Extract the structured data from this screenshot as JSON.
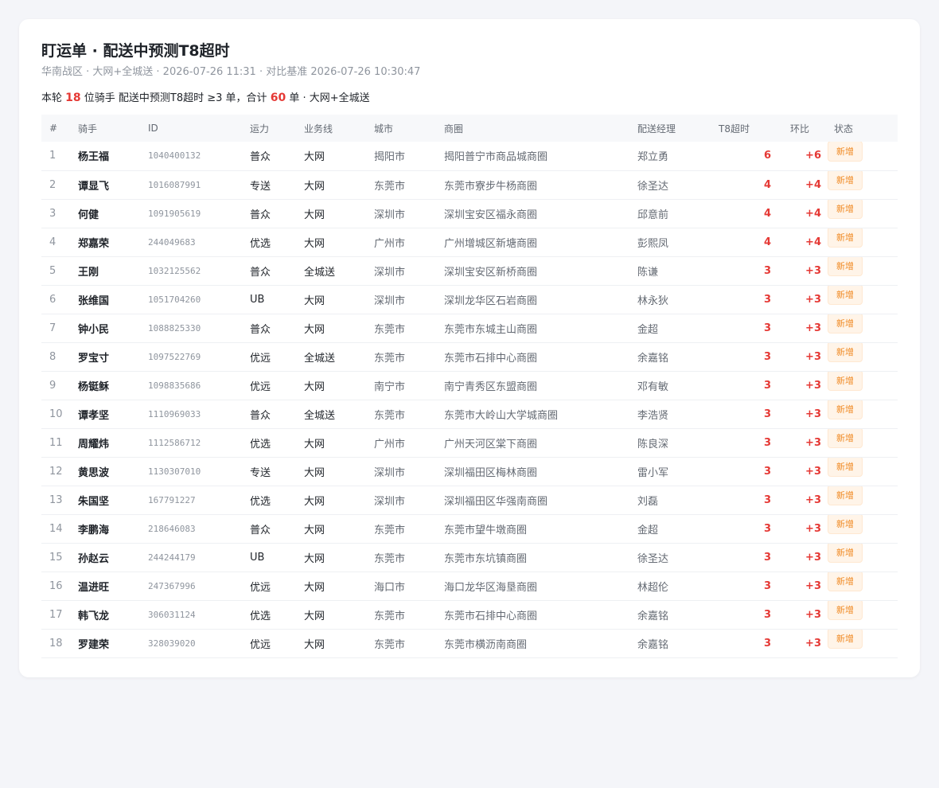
{
  "header": {
    "title": "盯运单 · 配送中预测T8超时",
    "subtitle": "华南战区 · 大网+全城送 · 2026-07-26 11:31 · 对比基准 2026-07-26 10:30:47"
  },
  "summary": {
    "prefix": "本轮",
    "rider_count": "18",
    "middle": "位骑手 配送中预测T8超时 ≥3 单，合计",
    "order_total": "60",
    "suffix": "单 · 大网+全城送"
  },
  "table": {
    "columns": [
      "#",
      "骑手",
      "ID",
      "运力",
      "业务线",
      "城市",
      "商圈",
      "配送经理",
      "T8超时",
      "环比",
      "状态"
    ],
    "rows": [
      {
        "idx": "1",
        "rider": "杨王福",
        "id": "1040400132",
        "cap": "普众",
        "biz": "大网",
        "city": "揭阳市",
        "zone": "揭阳普宁市商品城商圈",
        "mgr": "郑立勇",
        "t8": "6",
        "chg": "+6",
        "status": "新增"
      },
      {
        "idx": "2",
        "rider": "谭显飞",
        "id": "1016087991",
        "cap": "专送",
        "biz": "大网",
        "city": "东莞市",
        "zone": "东莞市寮步牛杨商圈",
        "mgr": "徐圣达",
        "t8": "4",
        "chg": "+4",
        "status": "新增"
      },
      {
        "idx": "3",
        "rider": "何健",
        "id": "1091905619",
        "cap": "普众",
        "biz": "大网",
        "city": "深圳市",
        "zone": "深圳宝安区福永商圈",
        "mgr": "邱意前",
        "t8": "4",
        "chg": "+4",
        "status": "新增"
      },
      {
        "idx": "4",
        "rider": "郑嘉荣",
        "id": "244049683",
        "cap": "优选",
        "biz": "大网",
        "city": "广州市",
        "zone": "广州增城区新塘商圈",
        "mgr": "彭熙凤",
        "t8": "4",
        "chg": "+4",
        "status": "新增"
      },
      {
        "idx": "5",
        "rider": "王刚",
        "id": "1032125562",
        "cap": "普众",
        "biz": "全城送",
        "city": "深圳市",
        "zone": "深圳宝安区新桥商圈",
        "mgr": "陈谦",
        "t8": "3",
        "chg": "+3",
        "status": "新增"
      },
      {
        "idx": "6",
        "rider": "张维国",
        "id": "1051704260",
        "cap": "UB",
        "biz": "大网",
        "city": "深圳市",
        "zone": "深圳龙华区石岩商圈",
        "mgr": "林永狄",
        "t8": "3",
        "chg": "+3",
        "status": "新增"
      },
      {
        "idx": "7",
        "rider": "钟小民",
        "id": "1088825330",
        "cap": "普众",
        "biz": "大网",
        "city": "东莞市",
        "zone": "东莞市东城主山商圈",
        "mgr": "金超",
        "t8": "3",
        "chg": "+3",
        "status": "新增"
      },
      {
        "idx": "8",
        "rider": "罗宝寸",
        "id": "1097522769",
        "cap": "优远",
        "biz": "全城送",
        "city": "东莞市",
        "zone": "东莞市石排中心商圈",
        "mgr": "余嘉铭",
        "t8": "3",
        "chg": "+3",
        "status": "新增"
      },
      {
        "idx": "9",
        "rider": "杨铤稣",
        "id": "1098835686",
        "cap": "优远",
        "biz": "大网",
        "city": "南宁市",
        "zone": "南宁青秀区东盟商圈",
        "mgr": "邓有敏",
        "t8": "3",
        "chg": "+3",
        "status": "新增"
      },
      {
        "idx": "10",
        "rider": "谭孝坚",
        "id": "1110969033",
        "cap": "普众",
        "biz": "全城送",
        "city": "东莞市",
        "zone": "东莞市大岭山大学城商圈",
        "mgr": "李浩贤",
        "t8": "3",
        "chg": "+3",
        "status": "新增"
      },
      {
        "idx": "11",
        "rider": "周耀炜",
        "id": "1112586712",
        "cap": "优选",
        "biz": "大网",
        "city": "广州市",
        "zone": "广州天河区棠下商圈",
        "mgr": "陈良深",
        "t8": "3",
        "chg": "+3",
        "status": "新增"
      },
      {
        "idx": "12",
        "rider": "黄思波",
        "id": "1130307010",
        "cap": "专送",
        "biz": "大网",
        "city": "深圳市",
        "zone": "深圳福田区梅林商圈",
        "mgr": "雷小军",
        "t8": "3",
        "chg": "+3",
        "status": "新增"
      },
      {
        "idx": "13",
        "rider": "朱国坚",
        "id": "167791227",
        "cap": "优选",
        "biz": "大网",
        "city": "深圳市",
        "zone": "深圳福田区华强南商圈",
        "mgr": "刘磊",
        "t8": "3",
        "chg": "+3",
        "status": "新增"
      },
      {
        "idx": "14",
        "rider": "李鹏海",
        "id": "218646083",
        "cap": "普众",
        "biz": "大网",
        "city": "东莞市",
        "zone": "东莞市望牛墩商圈",
        "mgr": "金超",
        "t8": "3",
        "chg": "+3",
        "status": "新增"
      },
      {
        "idx": "15",
        "rider": "孙赵云",
        "id": "244244179",
        "cap": "UB",
        "biz": "大网",
        "city": "东莞市",
        "zone": "东莞市东坑镇商圈",
        "mgr": "徐圣达",
        "t8": "3",
        "chg": "+3",
        "status": "新增"
      },
      {
        "idx": "16",
        "rider": "温进旺",
        "id": "247367996",
        "cap": "优远",
        "biz": "大网",
        "city": "海口市",
        "zone": "海口龙华区海垦商圈",
        "mgr": "林超伦",
        "t8": "3",
        "chg": "+3",
        "status": "新增"
      },
      {
        "idx": "17",
        "rider": "韩飞龙",
        "id": "306031124",
        "cap": "优选",
        "biz": "大网",
        "city": "东莞市",
        "zone": "东莞市石排中心商圈",
        "mgr": "余嘉铭",
        "t8": "3",
        "chg": "+3",
        "status": "新增"
      },
      {
        "idx": "18",
        "rider": "罗建荣",
        "id": "328039020",
        "cap": "优远",
        "biz": "大网",
        "city": "东莞市",
        "zone": "东莞市横沥南商圈",
        "mgr": "余嘉铭",
        "t8": "3",
        "chg": "+3",
        "status": "新增"
      }
    ]
  },
  "colors": {
    "accent_red": "#e53935",
    "badge_orange": "#f08a24",
    "badge_bg": "#fff4e8"
  }
}
